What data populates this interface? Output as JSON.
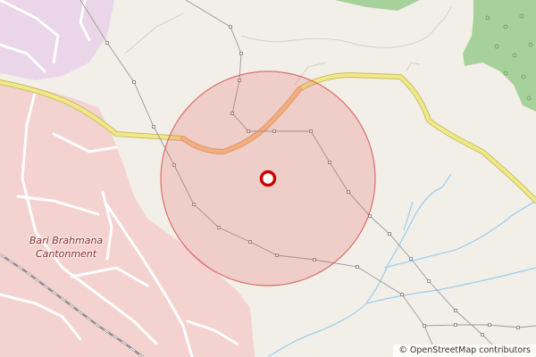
{
  "map": {
    "place_label_line1": "Bari Brahmana",
    "place_label_line2": "Cantonment",
    "attribution": "© OpenStreetMap contributors",
    "colors": {
      "background": "#f2efe9",
      "urban_pink": "#f4d2d0",
      "urban_purple": "#ead6e8",
      "forest": "#a7d19a",
      "primary_road": "#f0e98a",
      "primary_road_casing": "#c9bd5e",
      "secondary_road": "#f6c68d",
      "railway": "#8f8f8f",
      "river": "#9ccdec",
      "power_line": "#9a9a9a",
      "radius_fill": "#e35c5c",
      "marker": "#cc0000"
    },
    "icons": [
      "location-marker-icon",
      "tree-icon"
    ]
  }
}
